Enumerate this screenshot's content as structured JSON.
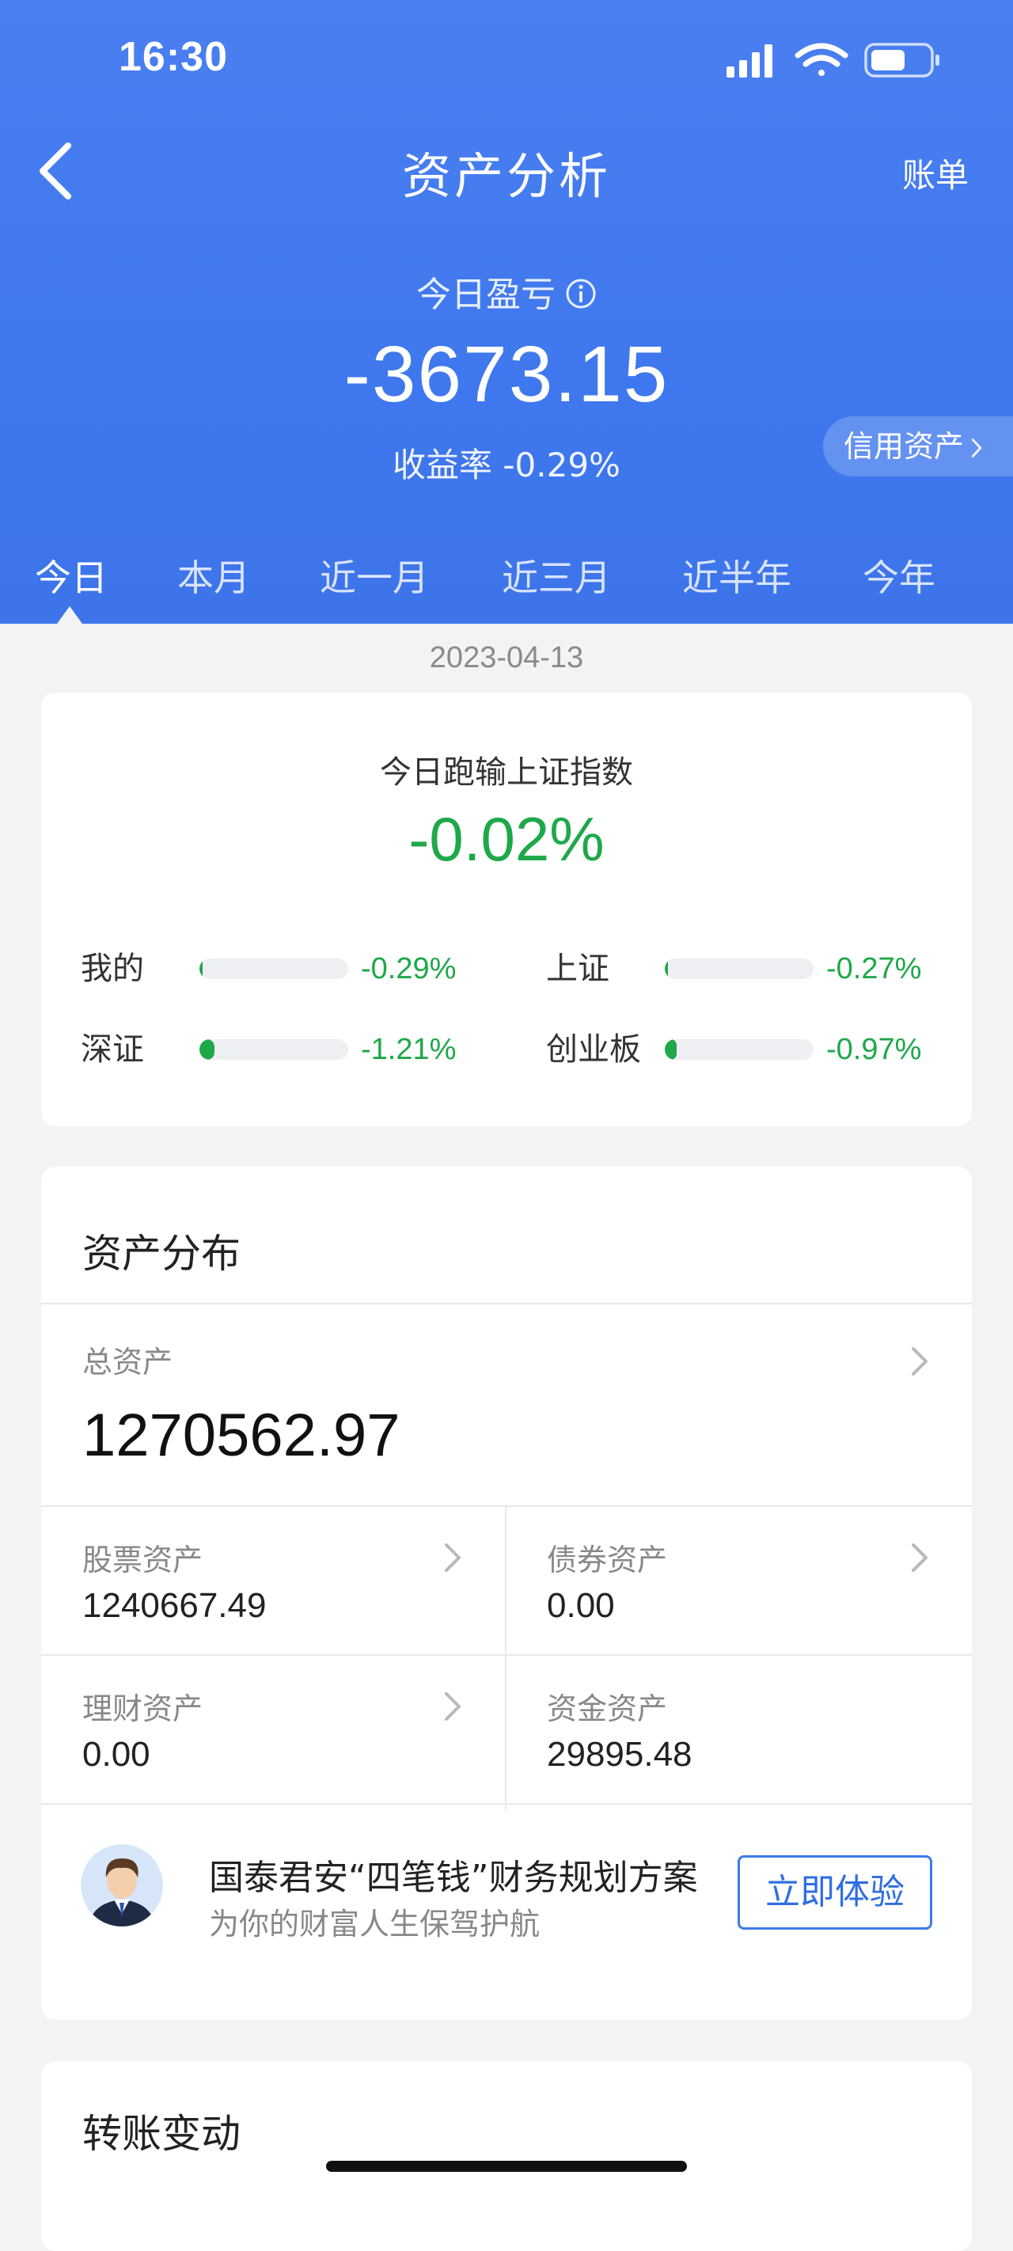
{
  "status_bar": {
    "time": "16:30",
    "icons": [
      "signal-icon",
      "wifi-icon",
      "battery-icon"
    ]
  },
  "nav": {
    "back_icon": "chevron-left-icon",
    "title": "资产分析",
    "right_link": "账单"
  },
  "summary": {
    "pnl_label": "今日盈亏",
    "info_icon": "info-icon",
    "pnl_value": "-3673.15",
    "yield_label": "收益率",
    "yield_value": "-0.29%",
    "credit_assets": "信用资产"
  },
  "period_tabs": [
    {
      "label": "今日",
      "active": true
    },
    {
      "label": "本月",
      "active": false
    },
    {
      "label": "近一月",
      "active": false
    },
    {
      "label": "近三月",
      "active": false
    },
    {
      "label": "近半年",
      "active": false
    },
    {
      "label": "今年",
      "active": false
    }
  ],
  "date": "2023-04-13",
  "benchmark": {
    "title": "今日跑输上证指数",
    "value": "-0.02%",
    "items": [
      {
        "label": "我的",
        "value": "-0.29%",
        "bar_fraction": 0.02
      },
      {
        "label": "上证",
        "value": "-0.27%",
        "bar_fraction": 0.02
      },
      {
        "label": "深证",
        "value": "-1.21%",
        "bar_fraction": 0.1
      },
      {
        "label": "创业板",
        "value": "-0.97%",
        "bar_fraction": 0.08
      }
    ]
  },
  "assets": {
    "title": "资产分布",
    "total_label": "总资产",
    "total_value": "1270562.97",
    "cells": [
      {
        "label": "股票资产",
        "value": "1240667.49",
        "has_arrow": true
      },
      {
        "label": "债券资产",
        "value": "0.00",
        "has_arrow": true
      },
      {
        "label": "理财资产",
        "value": "0.00",
        "has_arrow": true
      },
      {
        "label": "资金资产",
        "value": "29895.48",
        "has_arrow": false
      }
    ],
    "plan": {
      "title": "国泰君安“四笔钱”财务规划方案",
      "subtitle": "为你的财富人生保驾护航",
      "button": "立即体验"
    }
  },
  "transfer": {
    "title": "转账变动"
  },
  "colors": {
    "header_blue": "#4a7ff0",
    "loss_green": "#1ea84a",
    "button_blue": "#3d7ae8",
    "page_bg": "#f2f3f5"
  }
}
